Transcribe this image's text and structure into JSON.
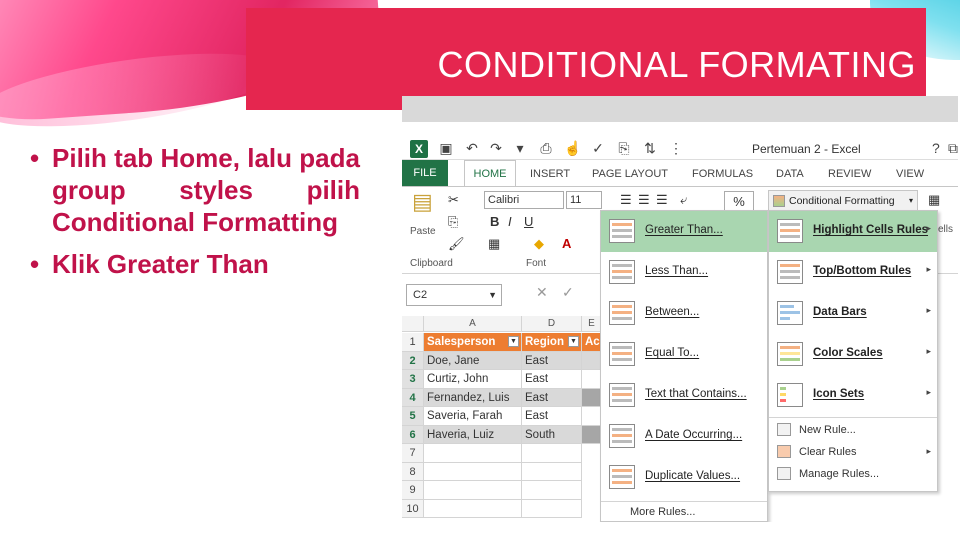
{
  "slide": {
    "title": "CONDITIONAL FORMATING",
    "bullets": [
      "Pilih tab Home, lalu pada group styles pilih Conditional Formatting",
      "Klik Greater Than"
    ],
    "colors": {
      "title_bg": "#e5264f",
      "bullet_text": "#c0124a",
      "excel_green": "#217346",
      "header_orange": "#ed7d31"
    }
  },
  "excel": {
    "window_title": "Pertemuan 2 - Excel",
    "window_controls": [
      "?",
      "⧉"
    ],
    "tabs": [
      "FILE",
      "HOME",
      "INSERT",
      "PAGE LAYOUT",
      "FORMULAS",
      "DATA",
      "REVIEW",
      "VIEW"
    ],
    "ribbon": {
      "paste_label": "Paste",
      "clipboard_label": "Clipboard",
      "font_label": "Font",
      "font_name": "Calibri",
      "font_size": "11",
      "percent_symbol": "%",
      "conditional_formatting": "Conditional Formatting",
      "cells_label": "ells"
    },
    "name_box": "C2",
    "columns": [
      "A",
      "D",
      "E"
    ],
    "rows": [
      "1",
      "2",
      "3",
      "4",
      "5",
      "6",
      "7",
      "8",
      "9",
      "10"
    ],
    "table": {
      "headers": [
        "Salesperson",
        "Region",
        "Ac"
      ],
      "data": [
        [
          "Doe, Jane",
          "East"
        ],
        [
          "Curtiz, John",
          "East"
        ],
        [
          "Fernandez, Luis",
          "East"
        ],
        [
          "Saveria, Farah",
          "East"
        ],
        [
          "Haveria, Luiz",
          "South"
        ]
      ]
    },
    "highlight_menu": {
      "items": [
        "Greater Than...",
        "Less Than...",
        "Between...",
        "Equal To...",
        "Text that Contains...",
        "A Date Occurring...",
        "Duplicate Values..."
      ],
      "more_rules": "More Rules..."
    },
    "cf_menu": {
      "items": [
        "Highlight Cells Rules",
        "Top/Bottom Rules",
        "Data Bars",
        "Color Scales",
        "Icon Sets"
      ],
      "small_items": [
        "New Rule...",
        "Clear Rules",
        "Manage Rules..."
      ]
    }
  }
}
